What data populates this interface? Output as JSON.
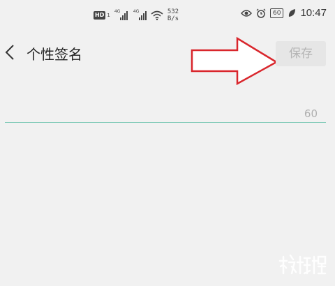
{
  "status_bar": {
    "hd_badge": "HD",
    "sim_number": "1",
    "signal_1_tag": "4G",
    "signal_2_tag": "4G",
    "net_speed_value": "532",
    "net_speed_unit": "B/s",
    "battery_level": "60",
    "time": "10:47"
  },
  "header": {
    "title": "个性签名",
    "save_label": "保存"
  },
  "signature_input": {
    "value": "",
    "char_count": "60"
  },
  "colors": {
    "background": "#f1f1f1",
    "accent_underline": "#7cc9b5",
    "annotation_arrow": "#d9262c",
    "disabled_text": "#b4b4b4"
  },
  "icons": [
    "eye-icon",
    "alarm-icon",
    "battery-icon",
    "leaf-icon",
    "wifi-icon",
    "back-chevron-icon"
  ]
}
